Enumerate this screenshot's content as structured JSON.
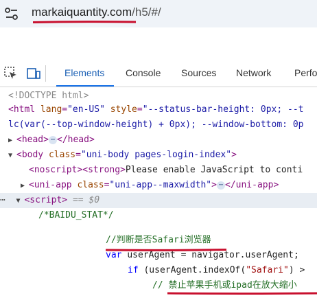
{
  "address_bar": {
    "url_domain": "markaiquantity.com",
    "url_path": "/h5/#/",
    "icon": "tune-icon",
    "underline_color": "#c8102e"
  },
  "devtools": {
    "tools": [
      "element-picker-icon",
      "device-toolbar-icon"
    ],
    "tabs": [
      "Elements",
      "Console",
      "Sources",
      "Network",
      "Perfo"
    ],
    "active_tab": "Elements",
    "accent_color": "#1a73e8"
  },
  "code": {
    "doctype": "<!DOCTYPE html>",
    "html_open": "<html",
    "html_lang_attr": "lang",
    "html_lang_val": "\"en-US\"",
    "html_style_attr": "style",
    "html_style_val": "\"--status-bar-height: 0px; --t",
    "html_style_cont": "lc(var(--top-window-height) + 0px); --window-bottom: 0p",
    "head_open": "<head>",
    "head_close": "</head>",
    "ellipsis": "⋯",
    "body_open": "<body",
    "body_class_attr": "class",
    "body_class_val": "\"uni-body pages-login-index\"",
    "noscript_open": "<noscript>",
    "strong_open": "<strong>",
    "noscript_text": "Please enable JavaScript to conti",
    "uniapp_open": "<uni-app",
    "uniapp_class_attr": "class",
    "uniapp_class_val": "\"uni-app--maxwidth\"",
    "uniapp_close": "</uni-app>",
    "script_open": "<script>",
    "script_eq": "== $0",
    "baidu_comment": "/*BAIDU_STAT*/",
    "safari_comment": "//判断是否Safari浏览器",
    "var_kw": "var",
    "user_agent_decl": "userAgent = navigator.userAgent;",
    "if_kw": "if",
    "if_expr_pre": "(userAgent.indexOf(",
    "if_expr_str": "\"Safari\"",
    "if_expr_post": ") >",
    "disable_zoom_comment": "// 禁止苹果手机或ipad在放大缩小",
    "dots": "⋯"
  }
}
